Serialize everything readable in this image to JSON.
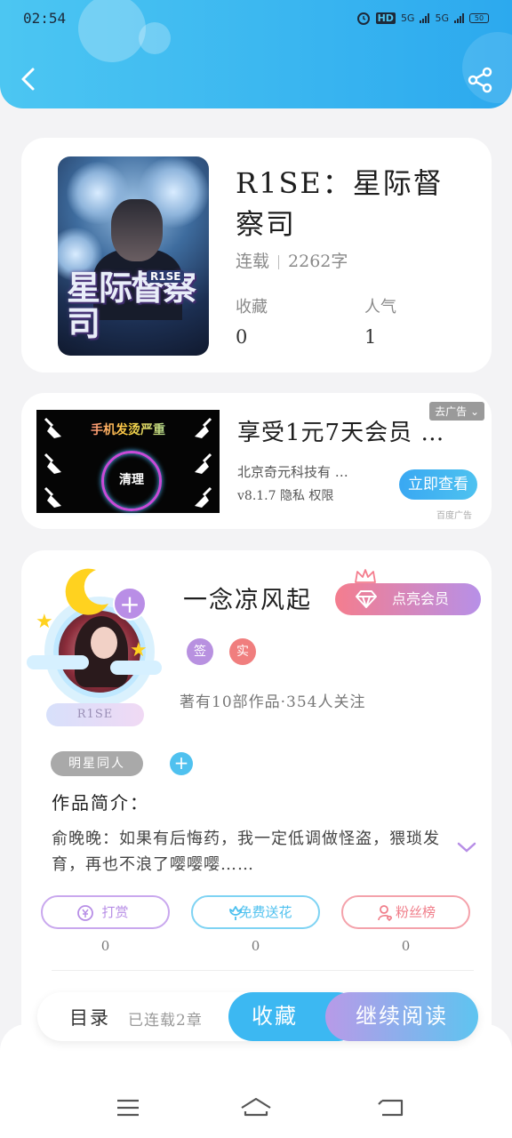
{
  "status": {
    "time": "02:54",
    "net1": "5G",
    "net2": "5G",
    "battery": "50",
    "hd": "HD"
  },
  "book": {
    "title": "R1SE：星际督察司",
    "status": "连载",
    "words": "2262字",
    "cover_title": "星际督察司",
    "cover_tag": "R1SE",
    "stats": [
      {
        "label": "收藏",
        "value": "0"
      },
      {
        "label": "人气",
        "value": "1"
      }
    ]
  },
  "ad": {
    "image_headline": "手机发烫严重",
    "image_button": "清理",
    "title": "享受1元7天会员 …",
    "company": "北京奇元科技有 …",
    "meta": "v8.1.7  隐私  权限",
    "cta": "立即查看",
    "close_label": "去广告",
    "source": "百度广告"
  },
  "author": {
    "name": "一念凉风起",
    "vip_button": "点亮会员",
    "badges": [
      {
        "label": "签",
        "color": "#b891e0"
      },
      {
        "label": "实",
        "color": "#f07e7e"
      }
    ],
    "frame_tag": "R1SE",
    "stats_text": "著有10部作品·354人关注",
    "tag": "明星同人",
    "intro_title": "作品简介：",
    "intro_text": "俞晚晚：如果有后悔药，我一定低调做怪盗，猥琐发育，再也不浪了嘤嘤嘤……",
    "actions": [
      {
        "label": "打赏",
        "count": "0",
        "color": "#b78ee6"
      },
      {
        "label": "免费送花",
        "count": "0",
        "color": "#4fc1ef"
      },
      {
        "label": "粉丝榜",
        "count": "0",
        "color": "#f07e8a"
      }
    ]
  },
  "reader_bar": {
    "toc_label": "目录",
    "toc_sub": "已连载2章",
    "favorite": "收藏",
    "continue_reading": "继续阅读"
  },
  "colors": {
    "primary": "#39b5f0",
    "accent_purple": "#b78ee6",
    "accent_pink": "#f47d8e"
  }
}
